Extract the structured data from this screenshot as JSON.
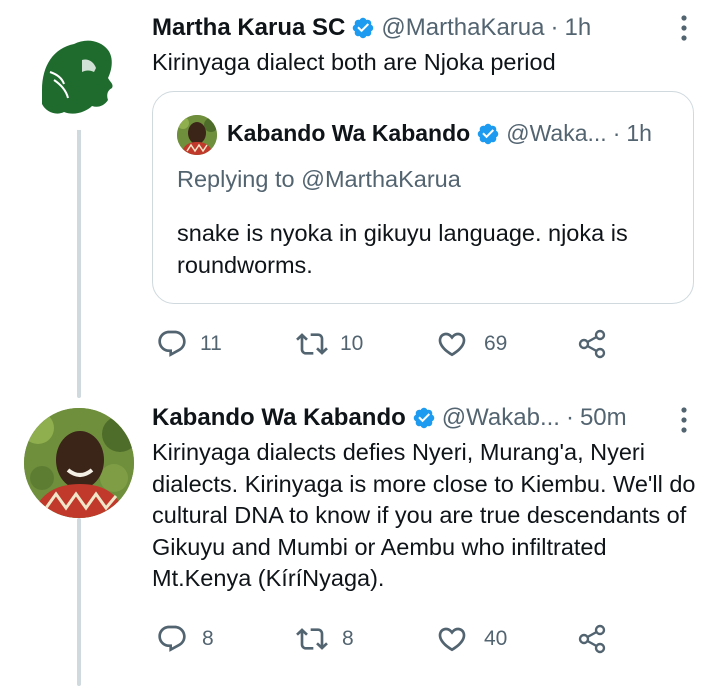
{
  "tweet1": {
    "name": "Martha Karua SC",
    "handle": "@MarthaKarua",
    "dot": "·",
    "time": "1h",
    "text": "Kirinyaga dialect both are Njoka period",
    "quote": {
      "name": "Kabando Wa Kabando",
      "handle": "@Waka...",
      "dot": "·",
      "time": "1h",
      "replying": "Replying to @MarthaKarua",
      "text": "snake is nyoka in gikuyu language. njoka is roundworms."
    },
    "actions": {
      "replies": "11",
      "retweets": "10",
      "likes": "69"
    }
  },
  "tweet2": {
    "name": "Kabando Wa Kabando",
    "handle": "@Wakab...",
    "dot": "·",
    "time": "50m",
    "text": "Kirinyaga dialects defies Nyeri, Murang'a, Nyeri dialects. Kirinyaga is more close to Kiembu. We'll do cultural DNA to know if you are true descendants of Gikuyu and Mumbi or Aembu who infiltrated Mt.Kenya (KíríNyaga).",
    "actions": {
      "replies": "8",
      "retweets": "8",
      "likes": "40"
    }
  },
  "colors": {
    "verified": "#1d9bf0",
    "muted": "#536471",
    "border": "#cfd9de",
    "logo_green": "#1f6b2e"
  },
  "icons": [
    "verified-badge-icon",
    "more-icon",
    "reply-icon",
    "retweet-icon",
    "like-icon",
    "share-icon"
  ]
}
